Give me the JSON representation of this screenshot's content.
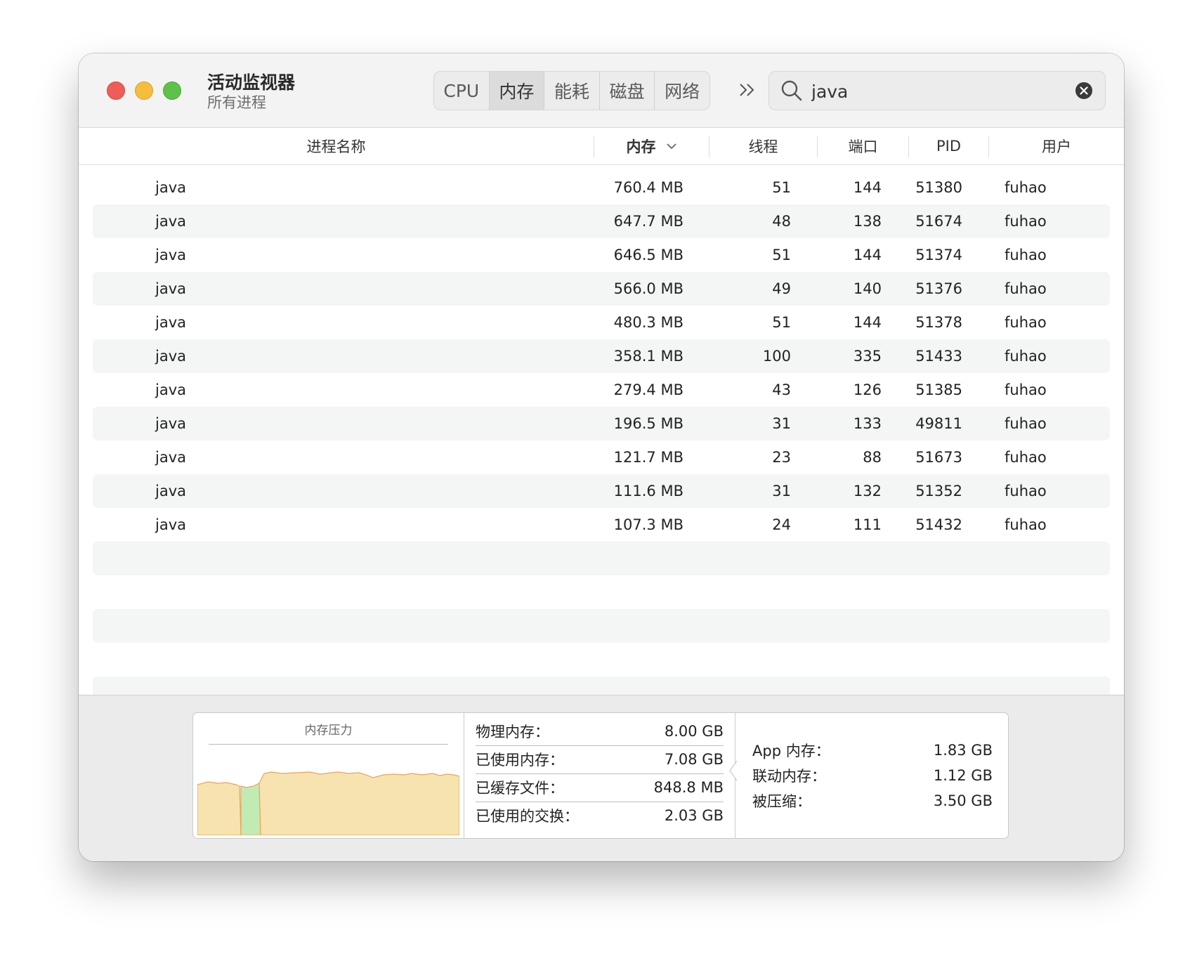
{
  "app": {
    "title": "活动监视器",
    "subtitle": "所有进程"
  },
  "tabs": [
    {
      "label": "CPU",
      "active": false
    },
    {
      "label": "内存",
      "active": true
    },
    {
      "label": "能耗",
      "active": false
    },
    {
      "label": "磁盘",
      "active": false
    },
    {
      "label": "网络",
      "active": false
    }
  ],
  "search": {
    "value": "java"
  },
  "columns": {
    "name": "进程名称",
    "memory": "内存",
    "threads": "线程",
    "ports": "端口",
    "pid": "PID",
    "user": "用户"
  },
  "rows": [
    {
      "name": "java",
      "memory": "760.4 MB",
      "threads": "51",
      "ports": "144",
      "pid": "51380",
      "user": "fuhao"
    },
    {
      "name": "java",
      "memory": "647.7 MB",
      "threads": "48",
      "ports": "138",
      "pid": "51674",
      "user": "fuhao"
    },
    {
      "name": "java",
      "memory": "646.5 MB",
      "threads": "51",
      "ports": "144",
      "pid": "51374",
      "user": "fuhao"
    },
    {
      "name": "java",
      "memory": "566.0 MB",
      "threads": "49",
      "ports": "140",
      "pid": "51376",
      "user": "fuhao"
    },
    {
      "name": "java",
      "memory": "480.3 MB",
      "threads": "51",
      "ports": "144",
      "pid": "51378",
      "user": "fuhao"
    },
    {
      "name": "java",
      "memory": "358.1 MB",
      "threads": "100",
      "ports": "335",
      "pid": "51433",
      "user": "fuhao"
    },
    {
      "name": "java",
      "memory": "279.4 MB",
      "threads": "43",
      "ports": "126",
      "pid": "51385",
      "user": "fuhao"
    },
    {
      "name": "java",
      "memory": "196.5 MB",
      "threads": "31",
      "ports": "133",
      "pid": "49811",
      "user": "fuhao"
    },
    {
      "name": "java",
      "memory": "121.7 MB",
      "threads": "23",
      "ports": "88",
      "pid": "51673",
      "user": "fuhao"
    },
    {
      "name": "java",
      "memory": "111.6 MB",
      "threads": "31",
      "ports": "132",
      "pid": "51352",
      "user": "fuhao"
    },
    {
      "name": "java",
      "memory": "107.3 MB",
      "threads": "24",
      "ports": "111",
      "pid": "51432",
      "user": "fuhao"
    }
  ],
  "footer": {
    "pressure_title": "内存压力",
    "stats": [
      {
        "label": "物理内存：",
        "value": "8.00 GB"
      },
      {
        "label": "已使用内存：",
        "value": "7.08 GB"
      },
      {
        "label": "已缓存文件：",
        "value": "848.8 MB"
      },
      {
        "label": "已使用的交换：",
        "value": "2.03 GB"
      }
    ],
    "breakdown": [
      {
        "label": "App 内存：",
        "value": "1.83 GB"
      },
      {
        "label": "联动内存：",
        "value": "1.12 GB"
      },
      {
        "label": "被压缩：",
        "value": "3.50 GB"
      }
    ]
  },
  "colors": {
    "pressure_yellow": "#f7e3b0",
    "pressure_green": "#c2ebb3",
    "pressure_line": "#e8a55a"
  }
}
